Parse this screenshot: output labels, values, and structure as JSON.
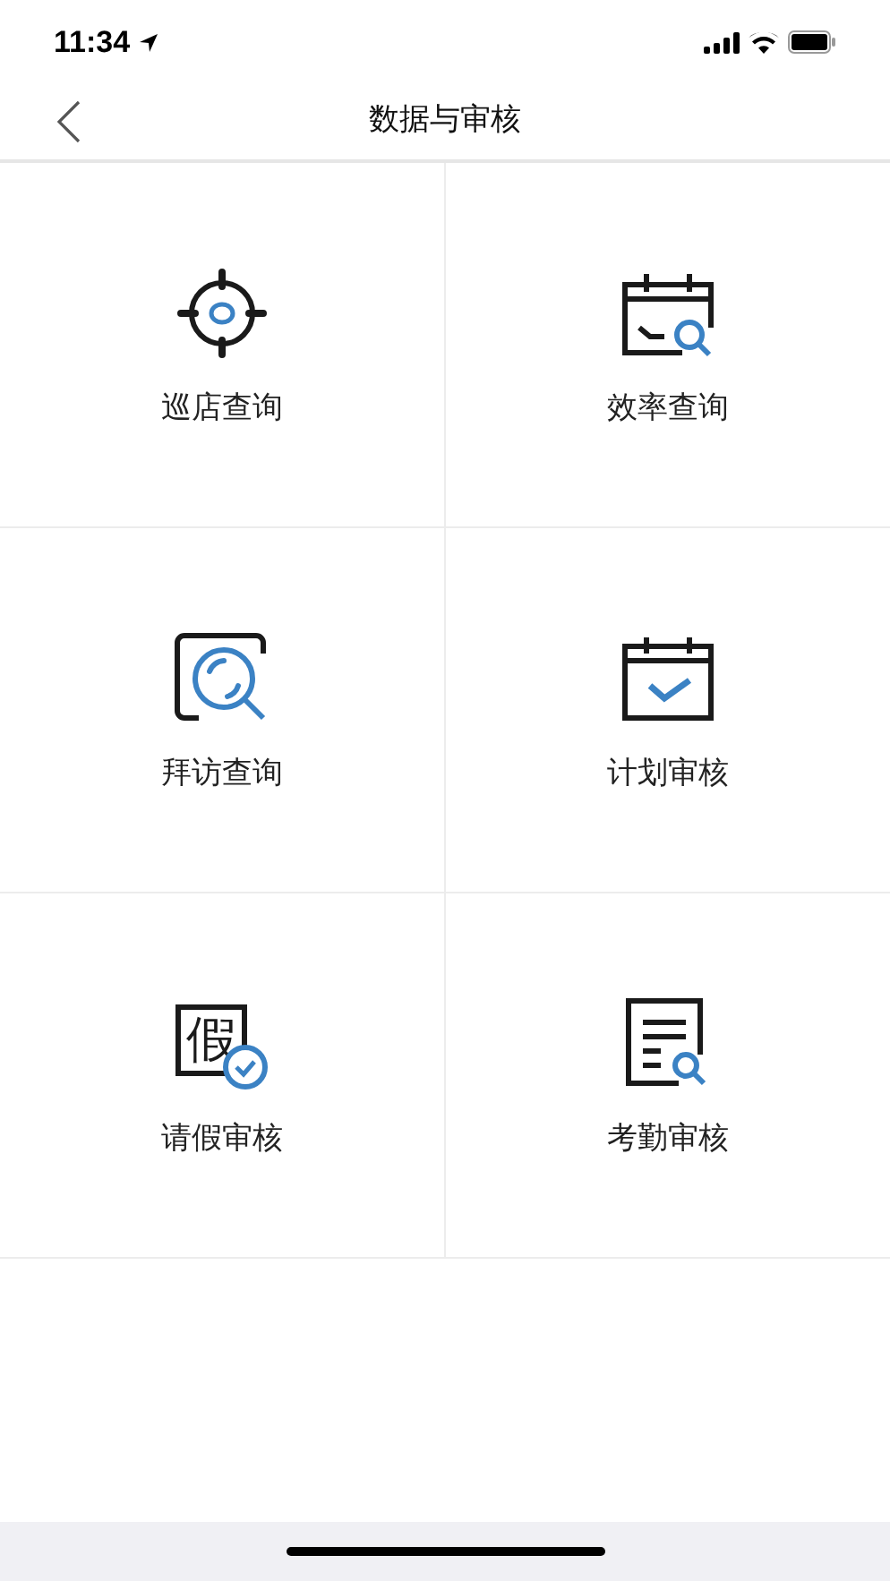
{
  "status_bar": {
    "time": "11:34"
  },
  "nav": {
    "title": "数据与审核"
  },
  "tiles": [
    {
      "kind": "target",
      "label": "巡店查询"
    },
    {
      "kind": "calendar-search",
      "label": "效率查询"
    },
    {
      "kind": "frame-search",
      "label": "拜访查询"
    },
    {
      "kind": "calendar-check",
      "label": "计划审核"
    },
    {
      "kind": "glyph-check",
      "label": "请假审核",
      "glyph": "假"
    },
    {
      "kind": "document-search",
      "label": "考勤审核"
    }
  ]
}
